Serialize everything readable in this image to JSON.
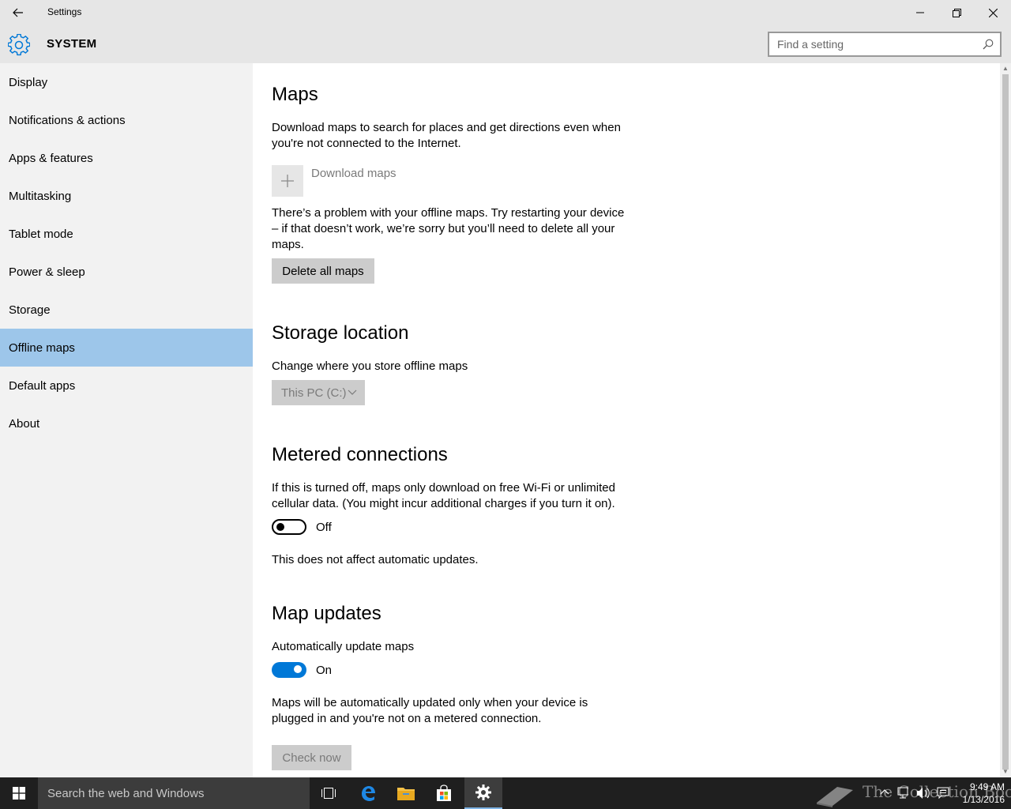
{
  "window": {
    "title": "Settings"
  },
  "header": {
    "title": "SYSTEM",
    "search_placeholder": "Find a setting"
  },
  "sidebar": {
    "items": [
      {
        "label": "Display"
      },
      {
        "label": "Notifications & actions"
      },
      {
        "label": "Apps & features"
      },
      {
        "label": "Multitasking"
      },
      {
        "label": "Tablet mode"
      },
      {
        "label": "Power & sleep"
      },
      {
        "label": "Storage"
      },
      {
        "label": "Offline maps",
        "selected": true
      },
      {
        "label": "Default apps"
      },
      {
        "label": "About"
      }
    ]
  },
  "maps": {
    "title": "Maps",
    "description": "Download maps to search for places and get directions even when you're not connected to the Internet.",
    "download_label": "Download maps",
    "problem_text": "There’s a problem with your offline maps. Try restarting your device – if that doesn’t work, we’re sorry but you’ll need to delete all your maps.",
    "delete_button": "Delete all maps"
  },
  "storage": {
    "title": "Storage location",
    "description": "Change where you store offline maps",
    "selected_value": "This PC (C:)"
  },
  "metered": {
    "title": "Metered connections",
    "description": "If this is turned off, maps only download on free Wi-Fi or unlimited cellular data. (You might incur additional charges if you turn it on).",
    "toggle_state": "Off",
    "note": "This does not affect automatic updates."
  },
  "updates": {
    "title": "Map updates",
    "toggle_heading": "Automatically update maps",
    "toggle_state": "On",
    "description": "Maps will be automatically updated only when your device is plugged in and you're not on a metered connection.",
    "check_button": "Check now"
  },
  "taskbar": {
    "search_text": "Search the web and Windows",
    "time": "9:49 AM",
    "date": "1/13/2016",
    "watermark": "The Collection Book"
  },
  "colors": {
    "accent": "#0078d7",
    "selected_nav": "#9dc6ea",
    "sidebar_bg": "#f2f2f2",
    "titlebar_bg": "#e6e6e6",
    "taskbar_bg": "#1f1f1f"
  }
}
